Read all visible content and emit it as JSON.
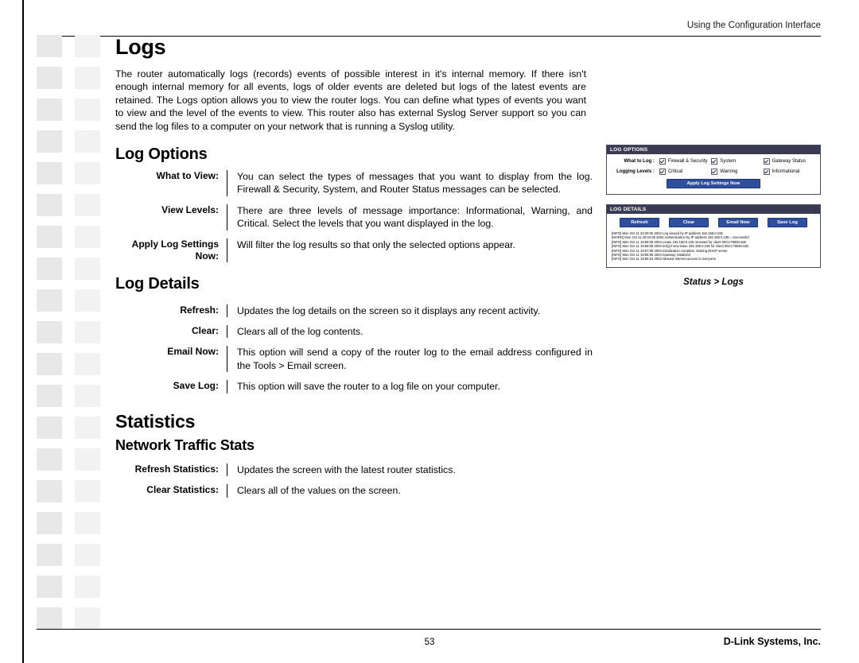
{
  "header": {
    "running_title": "Using the Configuration Interface"
  },
  "page": {
    "title": "Logs",
    "intro": "The router automatically logs (records) events of possible interest in it's internal memory. If there isn't enough internal memory for all events, logs of older events are deleted but logs of the latest events are retained. The Logs option allows you to view the router logs. You can define what types of events you want to view and the level of the events to view. This router also has external Syslog Server support so you can send the log files to a computer on your network that is running a Syslog utility."
  },
  "sections": [
    {
      "heading": "Log Options",
      "rows": [
        {
          "label": "What to View:",
          "desc": "You can select the types of messages that you want to display from the log. Firewall & Security, System, and Router Status messages can be selected."
        },
        {
          "label": "View Levels:",
          "desc": "There are three levels of message importance: Informational, Warning, and Critical. Select the levels that you want displayed in the log."
        },
        {
          "label": "Apply Log Settings Now:",
          "desc": "Will filter the log results so that only the selected options appear."
        }
      ]
    },
    {
      "heading": "Log Details",
      "rows": [
        {
          "label": "Refresh:",
          "desc": "Updates the log details on the screen so it displays any recent activity."
        },
        {
          "label": "Clear:",
          "desc": "Clears all of the log contents."
        },
        {
          "label": "Email Now:",
          "desc": "This option will send a copy of the router log to the email address configured in the Tools > Email screen."
        },
        {
          "label": "Save Log:",
          "desc": "This option will save the router to a log file on your computer."
        }
      ]
    }
  ],
  "statistics": {
    "heading": "Statistics",
    "subheading": "Network Traffic Stats",
    "rows": [
      {
        "label": "Refresh Statistics:",
        "desc": "Updates the screen with the latest router statistics."
      },
      {
        "label": "Clear Statistics:",
        "desc": "Clears all of the values on the screen."
      }
    ]
  },
  "figure": {
    "log_options": {
      "panel_title": "LOG OPTIONS",
      "what_to_log_label": "What to Log :",
      "logging_levels_label": "Logging Levels :",
      "what_to_log_items": [
        "Firewall & Security",
        "System",
        "Gateway Status"
      ],
      "logging_level_items": [
        "Critical",
        "Warning",
        "Informational"
      ],
      "apply_button": "Apply Log Settings Now"
    },
    "log_details": {
      "panel_title": "LOG DETAILS",
      "buttons": [
        "Refresh",
        "Clear",
        "Email Now",
        "Save Log"
      ],
      "lines": [
        "[INFO] Mon Oct 11 20:29:05 2004 Log viewed by IP address 192.168.0.105",
        "[WARN] Mon Oct 11 20:04:05 2004 Authentication by IP address 192.168.0.105 = Successful",
        "[INFO] Mon Oct 11 19:58:08 2004 Lease 192.168.0.105 renewed for client 00CC7669A41B",
        "[INFO] Mon Oct 11 19:58:08 2004 Dcfg'd new lease 192.168.0.105 for client 00CC7669A41B",
        "[INFO] Mon Oct 11 19:57:08 2004 Initialization complete, starting DHCP server",
        "[INFO] Mon Oct 11 19:56:55 2004 Gateway initialized",
        "[INFO] Mon Oct 11 19:56:53 2004 Allowed Internet access to everyone"
      ]
    },
    "caption": "Status > Logs"
  },
  "footer": {
    "page_number": "53",
    "company": "D-Link Systems, Inc."
  },
  "squares": {
    "rows": 19
  }
}
